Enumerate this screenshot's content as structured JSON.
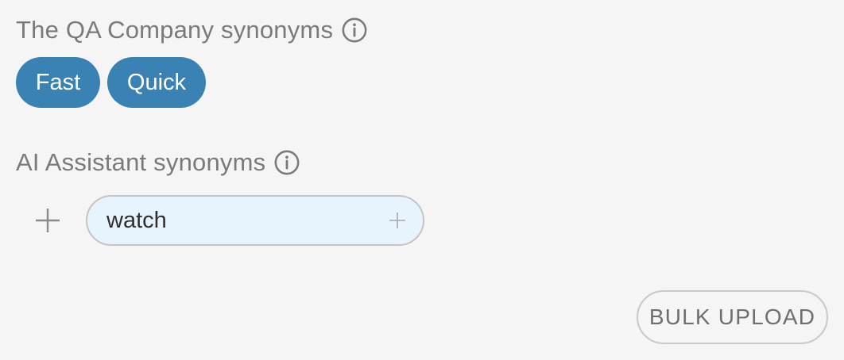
{
  "company_synonyms": {
    "label": "The QA Company synonyms",
    "info_icon": "info-circle-icon",
    "chips": [
      "Fast",
      "Quick"
    ],
    "chip_color": "#3b82b4"
  },
  "ai_synonyms": {
    "label": "AI Assistant synonyms",
    "info_icon": "info-circle-icon",
    "add_icon": "plus-icon",
    "input_value": "watch",
    "input_background": "#e8f4fd"
  },
  "actions": {
    "bulk_upload_label": "BULK UPLOAD"
  }
}
